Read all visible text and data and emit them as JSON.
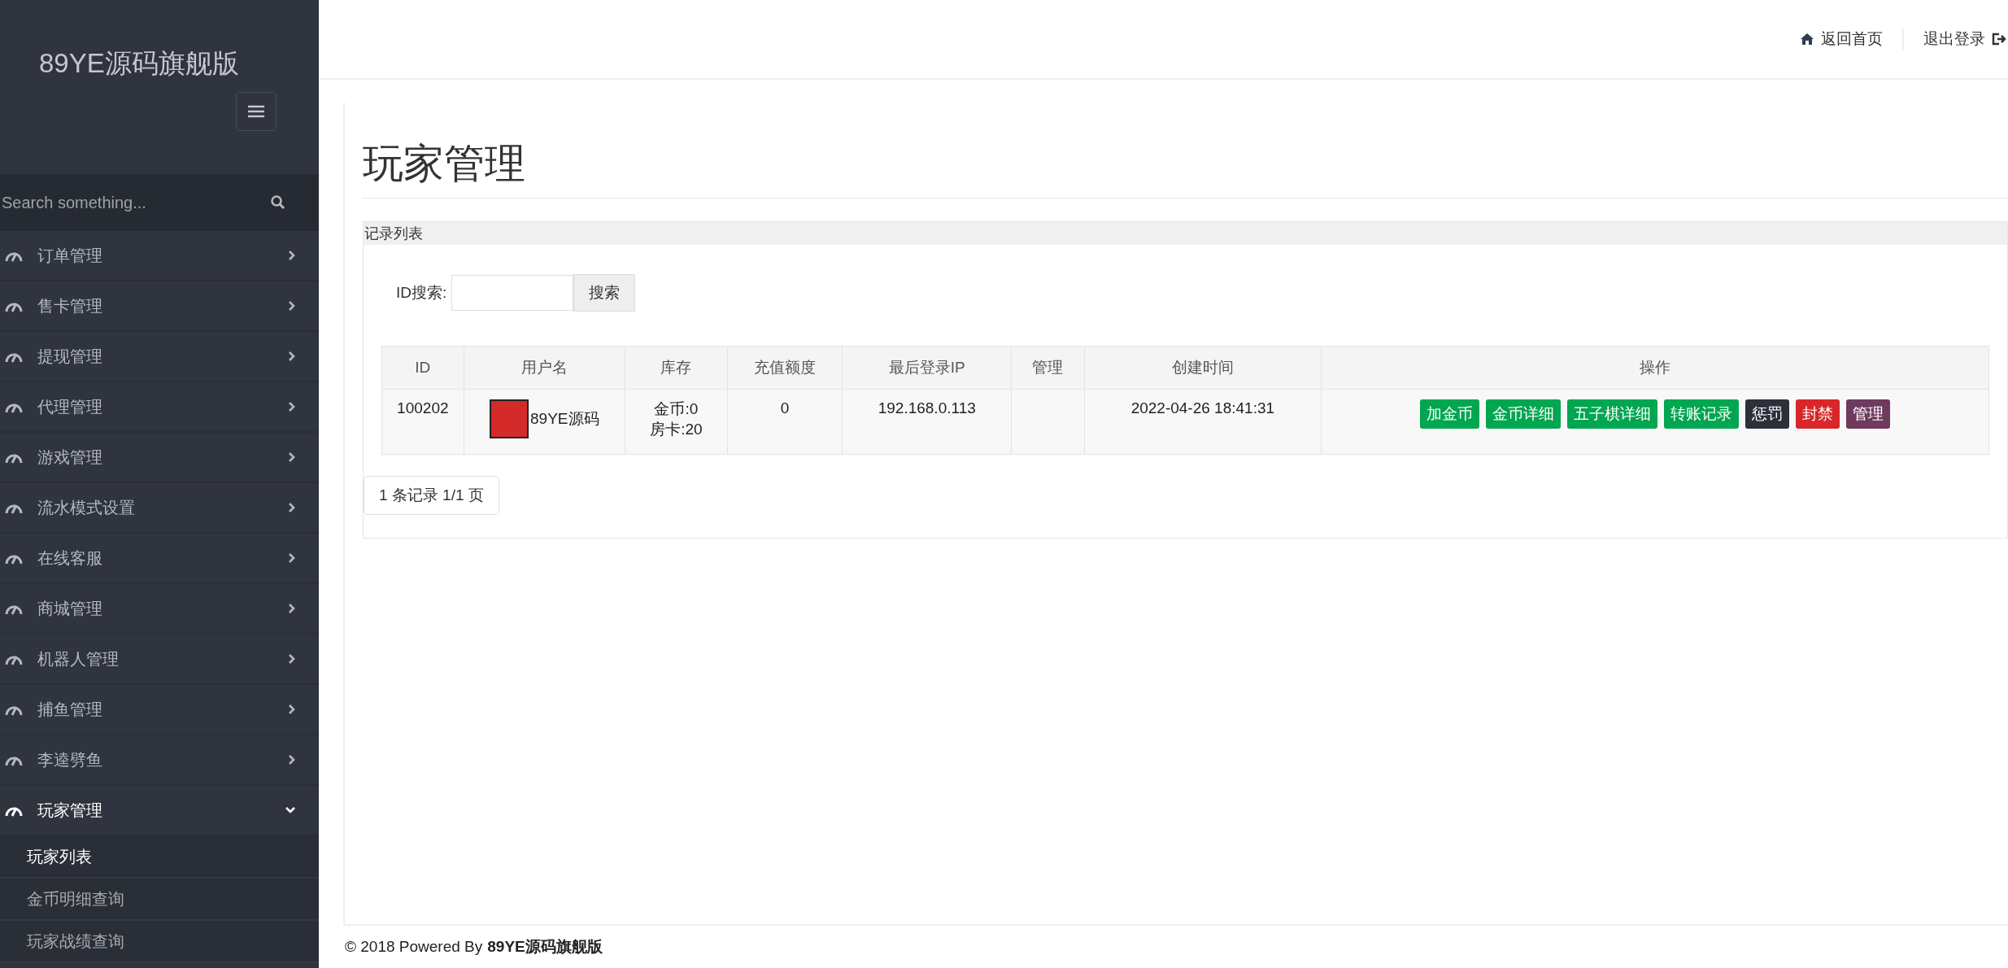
{
  "sidebar": {
    "brand": "89YE源码旗舰版",
    "search": {
      "placeholder": "Search something..."
    },
    "items": [
      {
        "label": "订单管理",
        "expanded": false,
        "selected": false
      },
      {
        "label": "售卡管理",
        "expanded": false,
        "selected": false
      },
      {
        "label": "提现管理",
        "expanded": false,
        "selected": false
      },
      {
        "label": "代理管理",
        "expanded": false,
        "selected": false
      },
      {
        "label": "游戏管理",
        "expanded": false,
        "selected": false
      },
      {
        "label": "流水模式设置",
        "expanded": false,
        "selected": false
      },
      {
        "label": "在线客服",
        "expanded": false,
        "selected": false
      },
      {
        "label": "商城管理",
        "expanded": false,
        "selected": false
      },
      {
        "label": "机器人管理",
        "expanded": false,
        "selected": false
      },
      {
        "label": "捕鱼管理",
        "expanded": false,
        "selected": false
      },
      {
        "label": "李逵劈鱼",
        "expanded": false,
        "selected": false
      },
      {
        "label": "玩家管理",
        "expanded": true,
        "selected": true,
        "children": [
          {
            "label": "玩家列表",
            "selected": true
          },
          {
            "label": "金币明细查询",
            "selected": false
          },
          {
            "label": "玩家战绩查询",
            "selected": false
          }
        ]
      }
    ]
  },
  "header": {
    "links": [
      {
        "kind": "home",
        "label": "返回首页"
      },
      {
        "kind": "logout",
        "label": "退出登录"
      }
    ]
  },
  "page": {
    "title": "玩家管理",
    "panel_title": "记录列表",
    "search": {
      "label": "ID搜索:",
      "button": "搜索"
    },
    "table": {
      "columns": [
        "ID",
        "用户名",
        "库存",
        "充值额度",
        "最后登录IP",
        "管理",
        "创建时间",
        "操作"
      ],
      "rows": [
        {
          "id": "100202",
          "username": "89YE源码",
          "stock": [
            "金币:0",
            "房卡:20"
          ],
          "recharge": "0",
          "ip": "192.168.0.113",
          "created": "2022-04-26 18:41:31",
          "actions": [
            {
              "label": "加金币",
              "color": "#00a650"
            },
            {
              "label": "金币详细",
              "color": "#00a650"
            },
            {
              "label": "五子棋详细",
              "color": "#00a650"
            },
            {
              "label": "转账记录",
              "color": "#00a650"
            },
            {
              "label": "惩罚",
              "color": "#2b303b"
            },
            {
              "label": "封禁",
              "color": "#d9262a"
            },
            {
              "label": "管理",
              "color": "#6e3a5d"
            }
          ]
        }
      ]
    },
    "pagination": "1 条记录 1/1 页"
  },
  "footer": {
    "prefix": "© 2018 Powered By",
    "brand": "89YE源码旗舰版"
  }
}
